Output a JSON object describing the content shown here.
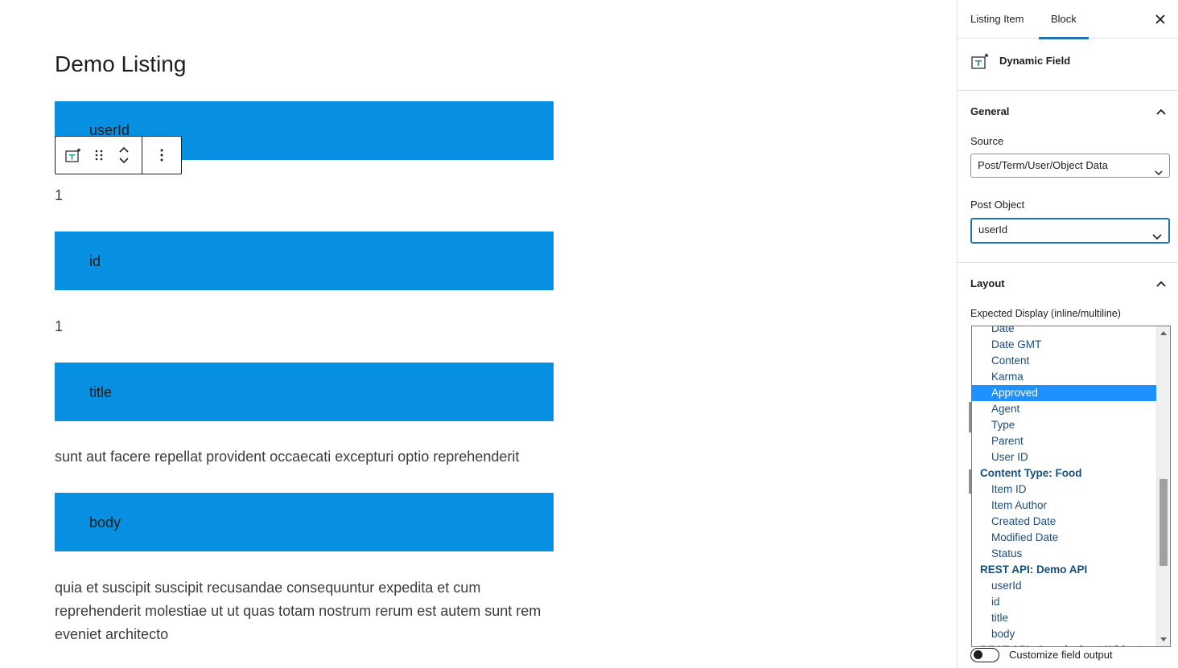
{
  "editor": {
    "post_title": "Demo Listing",
    "blocks": [
      {
        "label": "userId",
        "value": "1"
      },
      {
        "label": "id",
        "value": "1"
      },
      {
        "label": "title",
        "value": "sunt aut facere repellat provident occaecati excepturi optio reprehenderit"
      },
      {
        "label": "body",
        "value": "quia et suscipit suscipit recusandae consequuntur expedita et cum reprehenderit molestiae ut ut quas totam nostrum rerum est autem sunt rem eveniet architecto"
      }
    ],
    "block_color": "#0790e1",
    "toolbar": {
      "icons": [
        "dynamic-field-icon",
        "drag-handle-icon",
        "move-up-icon",
        "move-down-icon",
        "more-options-icon"
      ]
    }
  },
  "sidebar": {
    "tabs": [
      {
        "label": "Listing Item",
        "active": false
      },
      {
        "label": "Block",
        "active": true
      }
    ],
    "block_name": "Dynamic Field",
    "general": {
      "heading": "General",
      "source_label": "Source",
      "source_value": "Post/Term/User/Object Data",
      "post_object_label": "Post Object",
      "post_object_value": "userId"
    },
    "layout": {
      "heading": "Layout",
      "expected_display_label": "Expected Display (inline/multiline)"
    },
    "listbox": {
      "items": [
        {
          "label": "Date",
          "type": "option"
        },
        {
          "label": "Date GMT",
          "type": "option"
        },
        {
          "label": "Content",
          "type": "option"
        },
        {
          "label": "Karma",
          "type": "option"
        },
        {
          "label": "Approved",
          "type": "option",
          "selected": true
        },
        {
          "label": "Agent",
          "type": "option"
        },
        {
          "label": "Type",
          "type": "option"
        },
        {
          "label": "Parent",
          "type": "option"
        },
        {
          "label": "User ID",
          "type": "option"
        },
        {
          "label": "Content Type: Food",
          "type": "group"
        },
        {
          "label": "Item ID",
          "type": "option"
        },
        {
          "label": "Item Author",
          "type": "option"
        },
        {
          "label": "Created Date",
          "type": "option"
        },
        {
          "label": "Modified Date",
          "type": "option"
        },
        {
          "label": "Status",
          "type": "option"
        },
        {
          "label": "REST API: Demo API",
          "type": "group"
        },
        {
          "label": "userId",
          "type": "option"
        },
        {
          "label": "id",
          "type": "option"
        },
        {
          "label": "title",
          "type": "option"
        },
        {
          "label": "body",
          "type": "option"
        },
        {
          "label": "REST API: Googlesheet Widget",
          "type": "group"
        }
      ]
    },
    "toggle": {
      "label": "Customize field output",
      "checked": false
    },
    "accent_color": "#2271b1",
    "selected_option_color": "#1e90ff"
  }
}
